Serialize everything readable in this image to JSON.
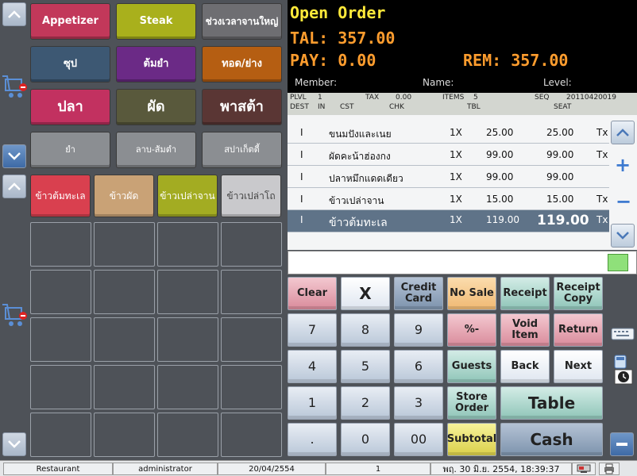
{
  "categories": [
    {
      "label": "Appetizer",
      "color": "#c2385a"
    },
    {
      "label": "Steak",
      "color": "#a9b01c"
    },
    {
      "label": "ช่วงเวลาจานใหญ่",
      "color": "#6e6e72"
    },
    {
      "label": "ซุป",
      "color": "#3d5873"
    },
    {
      "label": "ต้มยำ",
      "color": "#6b2a86"
    },
    {
      "label": "ทอด/ย่าง",
      "color": "#b55e12"
    },
    {
      "label": "ปลา",
      "color": "#c23160"
    },
    {
      "label": "ผัด",
      "color": "#59593c"
    },
    {
      "label": "พาสต้า",
      "color": "#5a3634"
    },
    {
      "label": "ยำ",
      "color": "#8b8e92"
    },
    {
      "label": "ลาบ-ส้มตำ",
      "color": "#8b8e92"
    },
    {
      "label": "สปาเก็ตตี้",
      "color": "#8b8e92"
    }
  ],
  "items": [
    {
      "label": "ข้าวต้มทะเล",
      "color": "#d9404f"
    },
    {
      "label": "ข้าวผัด",
      "color": "#c9a276"
    },
    {
      "label": "ข้าวเปล่าจาน",
      "color": "#a3ac22"
    },
    {
      "label": "ข้าวเปล่าโถ",
      "color": "#c9c9cc"
    }
  ],
  "header": {
    "title": "Open Order",
    "total": "TAL: 357.00",
    "pay": "PAY: 0.00",
    "rem": "REM: 357.00",
    "member": "Member:",
    "name": "Name:",
    "level": "Level:"
  },
  "meta": {
    "l1": [
      "PLVL",
      "1",
      "TAX",
      "0.00",
      "ITEMS",
      "5",
      "SEQ",
      "20110420019"
    ],
    "l2": [
      "DEST",
      "IN",
      "CST",
      "CHK",
      "TBL",
      "SEAT"
    ]
  },
  "orders": [
    {
      "flag": "I",
      "name": "ขนมปังและเนย",
      "qty": "1X",
      "price": "25.00",
      "amount": "25.00",
      "tax": "Tx"
    },
    {
      "flag": "I",
      "name": "ผัดคะน้าฮ่องกง",
      "qty": "1X",
      "price": "99.00",
      "amount": "99.00",
      "tax": "Tx"
    },
    {
      "flag": "I",
      "name": "ปลาหมึกแดดเดียว",
      "qty": "1X",
      "price": "99.00",
      "amount": "99.00",
      "tax": ""
    },
    {
      "flag": "I",
      "name": "ข้าวเปล่าจาน",
      "qty": "1X",
      "price": "15.00",
      "amount": "15.00",
      "tax": "Tx"
    },
    {
      "flag": "I",
      "name": "ข้าวต้มทะเล",
      "qty": "1X",
      "price": "119.00",
      "amount": "119.00",
      "tax": "Tx"
    }
  ],
  "side": {
    "plus": "+",
    "minus": "−"
  },
  "keys": {
    "clear": "Clear",
    "x": "X",
    "credit": "Credit Card",
    "nosale": "No Sale",
    "receipt": "Receipt",
    "receiptcopy": "Receipt Copy",
    "n7": "7",
    "n8": "8",
    "n9": "9",
    "pct": "%-",
    "void": "Void Item",
    "ret": "Return",
    "n4": "4",
    "n5": "5",
    "n6": "6",
    "guests": "Guests",
    "back": "Back",
    "next": "Next",
    "n1": "1",
    "n2": "2",
    "n3": "3",
    "store": "Store Order",
    "table": "Table",
    "dot": ".",
    "n0": "0",
    "n00": "00",
    "subtotal": "Subtotal",
    "cash": "Cash"
  },
  "status": {
    "mode": "Restaurant",
    "user": "administrator",
    "date": "20/04/2554",
    "terminal": "1",
    "clock": "พฤ. 30 มิ.ย. 2554, 18:39:37"
  },
  "colors": {
    "header_text": "#ff9d2e",
    "title_text": "#ffe93a"
  }
}
